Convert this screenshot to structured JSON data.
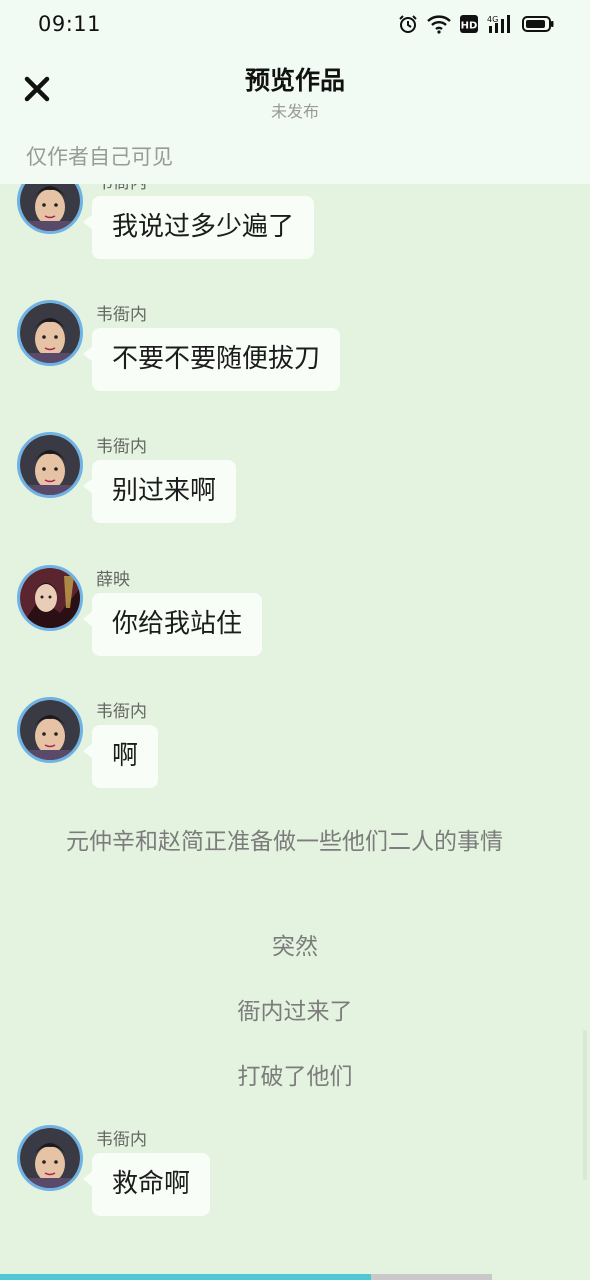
{
  "status_bar": {
    "time": "09:11",
    "battery_icon": "battery-icon",
    "icons": [
      "alarm-icon",
      "wifi-icon",
      "hd-icon",
      "signal-4g-icon",
      "battery-icon"
    ]
  },
  "header": {
    "title": "预览作品",
    "subtitle": "未发布",
    "close_icon": "close-icon",
    "visibility": "仅作者自己可见"
  },
  "messages": [
    {
      "name": "韦衙内",
      "text": "我说过多少遍了"
    },
    {
      "name": "韦衙内",
      "text": "不要不要随便拔刀"
    },
    {
      "name": "韦衙内",
      "text": "别过来啊"
    },
    {
      "name": "薛映",
      "text": "你给我站住"
    },
    {
      "name": "韦衙内",
      "text": "啊"
    },
    {
      "name": "韦衙内",
      "text": "救命啊"
    }
  ],
  "narration": {
    "paragraph": "元仲辛和赵简正准备做一些他们二人的事情",
    "line1": "突然",
    "line2": "衙内过来了",
    "line3": "打破了他们"
  },
  "progress": {
    "fraction": 0.755
  },
  "colors": {
    "background": "#e4f3df",
    "header_bg": "#f1fbf3",
    "bubble": "#f9fdf8",
    "avatar_ring": "#6fb3e6",
    "progress_fill": "#51c7d3"
  }
}
